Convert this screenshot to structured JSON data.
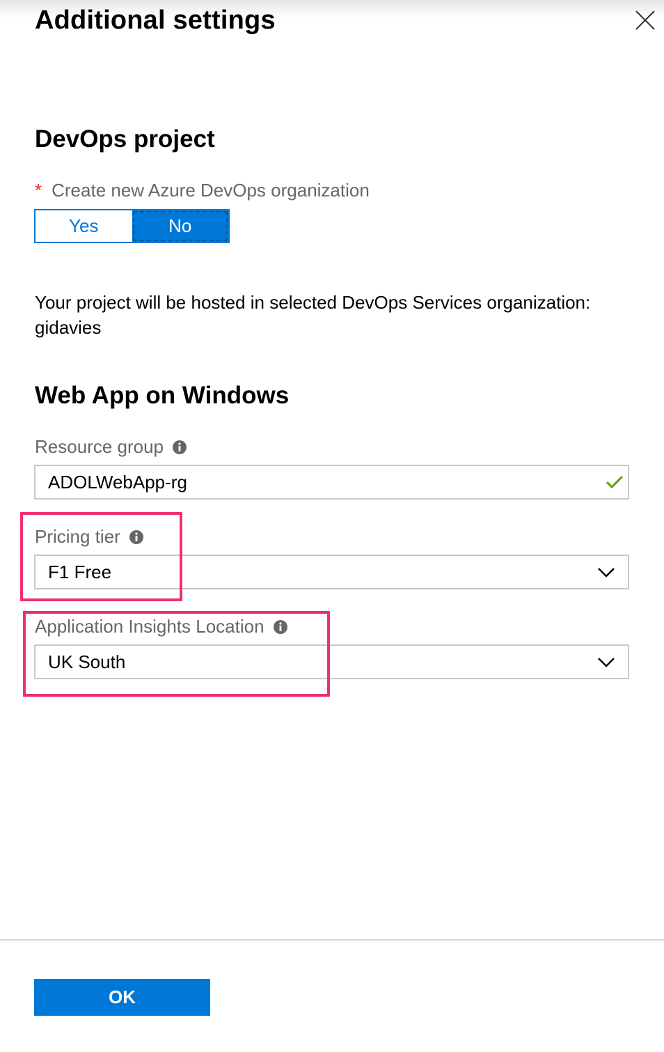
{
  "panel": {
    "title": "Additional settings",
    "close_icon": "close-icon"
  },
  "devops": {
    "heading": "DevOps project",
    "required_marker": "*",
    "create_org_label": "Create new Azure DevOps organization",
    "toggle": {
      "options": [
        "Yes",
        "No"
      ],
      "selected": "No"
    },
    "hosted_message": "Your project will be hosted in selected DevOps Services organization: gidavies"
  },
  "webapp": {
    "heading": "Web App on Windows",
    "resource_group": {
      "label": "Resource group",
      "value": "ADOLWebApp-rg",
      "valid_icon": "checkmark-icon"
    },
    "pricing_tier": {
      "label": "Pricing tier",
      "value": "F1 Free"
    },
    "app_insights_location": {
      "label": "Application Insights Location",
      "value": "UK South"
    }
  },
  "footer": {
    "ok_label": "OK"
  },
  "colors": {
    "accent": "#0078d7",
    "highlight": "#f0306e",
    "required": "#e0301e",
    "valid": "#57a300",
    "label": "#666666",
    "border": "#c8c8c8"
  }
}
